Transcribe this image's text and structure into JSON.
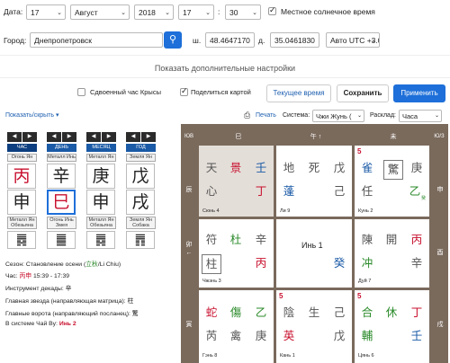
{
  "form": {
    "date_label": "Дата:",
    "day": "17",
    "month": "Август",
    "year": "2018",
    "hour": "17",
    "colon": ":",
    "minute": "30",
    "solar_time_label": "Местное солнечное время",
    "city_label": "Город:",
    "city_value": "Днепропетровск",
    "lat_label": "ш.",
    "lat_value": "48.4647170",
    "lon_label": "д.",
    "lon_value": "35.0461830",
    "tz_value": "Авто UTC +3.0",
    "more_settings": "Показать дополнительные настройки",
    "rat_hour_label": "Сдвоенный час Крысы",
    "share_label": "Поделиться картой",
    "current_time_btn": "Текущее время",
    "save_btn": "Сохранить",
    "apply_btn": "Применить"
  },
  "toolbar": {
    "show_hide": "Показать/скрыть ▾",
    "print": "Печать",
    "system_label": "Система:",
    "system_value": "Чжи Жунь (",
    "layout_label": "Расклад:",
    "layout_value": "Часа"
  },
  "pillars": {
    "headers": [
      "ЧАС",
      "ДЕНЬ",
      "МЕСЯЦ",
      "ГОД"
    ],
    "top_labels": [
      "Огонь Ян",
      "Металл Инь",
      "Металл Ян",
      "Земля Ян"
    ],
    "stems": [
      "丙",
      "辛",
      "庚",
      "戊"
    ],
    "branches": [
      "申",
      "巳",
      "申",
      "戌"
    ],
    "bottom_labels": [
      [
        "Металл Ян",
        "Обезьяна"
      ],
      [
        "Огонь Инь",
        "Змея"
      ],
      [
        "Металл Ян",
        "Обезьяна"
      ],
      [
        "Земля Ян",
        "Собака"
      ]
    ],
    "hexagrams": [
      "䷅",
      "䷀",
      "䷅",
      "䷋"
    ]
  },
  "info": {
    "season_label": "Сезон: Становление осени (",
    "season_glyph": "立秋",
    "season_suffix": "/Li Chiu)",
    "hour_label": "Час: ",
    "hour_glyphs": "丙申",
    "hour_time": " 15:39 - 17:39",
    "decade_label": "Инструмент декады: ",
    "decade_glyph": "辛",
    "star_label": "Главная звезда (направляющая матрица): ",
    "star_glyph": "柱",
    "gate_label": "Главные ворота (направляющий посланец): ",
    "gate_glyph": "驚",
    "system_label": "В системе Чай Ву: ",
    "system_value": "Инь 2"
  },
  "board": {
    "corner_tl": "ЮВ",
    "corner_tr": "Ю/З",
    "top_labels": [
      "巳",
      "午 ↑",
      "未"
    ],
    "left_labels": [
      "辰",
      "卯 ←",
      "寅"
    ],
    "right_labels": [
      "申",
      "酉",
      "戌"
    ],
    "center_label": "Инь 1",
    "cells": [
      {
        "rows": [
          [
            "天",
            "景",
            "壬"
          ],
          [
            "心",
            "",
            "丁"
          ]
        ],
        "label": "Сюнь 4"
      },
      {
        "rows": [
          [
            "地",
            "死",
            "戊"
          ],
          [
            "蓬",
            "",
            "己"
          ]
        ],
        "label": "Ли 9"
      },
      {
        "num": "5",
        "rows": [
          [
            "雀",
            "驚",
            "庚"
          ],
          [
            "任",
            "",
            "乙"
          ]
        ],
        "label": "Кунь 2",
        "sub": "癸"
      },
      {
        "rows": [
          [
            "符",
            "杜",
            "辛"
          ],
          [
            "柱",
            "",
            "丙"
          ]
        ],
        "label": "Чжэнь 3"
      },
      {
        "rows": [
          [
            "",
            "",
            ""
          ],
          [
            "",
            "",
            "癸"
          ]
        ],
        "label": ""
      },
      {
        "rows": [
          [
            "陳",
            "開",
            "丙"
          ],
          [
            "冲",
            "",
            "辛"
          ]
        ],
        "label": "Дуй 7"
      },
      {
        "rows": [
          [
            "蛇",
            "傷",
            "乙"
          ],
          [
            "芮",
            "禽",
            "庚"
          ]
        ],
        "label": "Гэнь 8"
      },
      {
        "num": "5",
        "rows": [
          [
            "陰",
            "生",
            "己"
          ],
          [
            "英",
            "",
            "戊"
          ]
        ],
        "label": "Кань 1"
      },
      {
        "num": "5",
        "rows": [
          [
            "合",
            "休",
            "丁"
          ],
          [
            "輔",
            "",
            "壬"
          ]
        ],
        "label": "Цянь 6"
      }
    ]
  }
}
